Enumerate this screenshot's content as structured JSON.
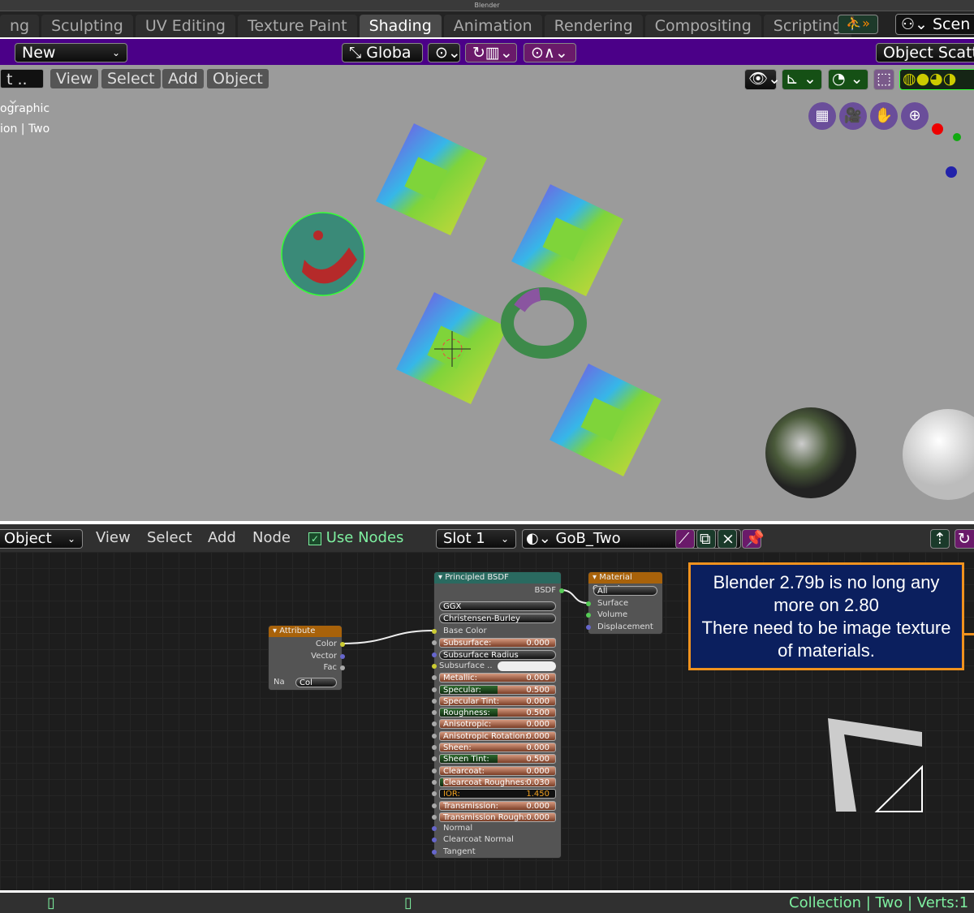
{
  "window": {
    "title": "Blender"
  },
  "workspace_tabs": [
    {
      "label": "ng"
    },
    {
      "label": "Sculpting"
    },
    {
      "label": "UV Editing"
    },
    {
      "label": "Texture Paint"
    },
    {
      "label": "Shading",
      "active": true
    },
    {
      "label": "Animation"
    },
    {
      "label": "Rendering"
    },
    {
      "label": "Compositing"
    },
    {
      "label": "Scripting"
    }
  ],
  "add_tab": "+",
  "scene_label": "Scen",
  "tool_header": {
    "new_label": "New",
    "orientation": "Globa",
    "object_scatter": "Object Scatt"
  },
  "viewport": {
    "mode": "t ..",
    "menus": [
      "View",
      "Select",
      "Add",
      "Object"
    ],
    "overlay_text_1": "ographic",
    "overlay_text_2": "ion | Two"
  },
  "node_header": {
    "object_type": "Object",
    "menus": [
      "View",
      "Select",
      "Add",
      "Node"
    ],
    "use_nodes_label": "Use Nodes",
    "use_nodes_checked": true,
    "slot": "Slot 1",
    "material_name": "GoB_Two"
  },
  "nodes": {
    "attribute": {
      "title": "Attribute",
      "outputs": [
        "Color",
        "Vector",
        "Fac"
      ],
      "name_label": "Na",
      "name_value": "Col"
    },
    "principled": {
      "title": "Principled BSDF",
      "output": "BSDF",
      "distribution": "GGX",
      "subsurface_method": "Christensen-Burley",
      "inputs": [
        {
          "type": "label",
          "label": "Base Color",
          "socket": "yellow"
        },
        {
          "type": "slider",
          "label": "Subsurface:",
          "value": "0.000",
          "fraction": 0
        },
        {
          "type": "dropdown",
          "label": "Subsurface Radius",
          "socket": "blue"
        },
        {
          "type": "color",
          "label": "Subsurface ..",
          "socket": "yellow"
        },
        {
          "type": "slider",
          "label": "Metallic:",
          "value": "0.000",
          "fraction": 0
        },
        {
          "type": "slider",
          "label": "Specular:",
          "value": "0.500",
          "fraction": 0.5
        },
        {
          "type": "slider",
          "label": "Specular Tint:",
          "value": "0.000",
          "fraction": 0
        },
        {
          "type": "slider",
          "label": "Roughness:",
          "value": "0.500",
          "fraction": 0.5
        },
        {
          "type": "slider",
          "label": "Anisotropic:",
          "value": "0.000",
          "fraction": 0
        },
        {
          "type": "slider",
          "label": "Anisotropic Rotation:",
          "value": "0.000",
          "fraction": 0
        },
        {
          "type": "slider",
          "label": "Sheen:",
          "value": "0.000",
          "fraction": 0
        },
        {
          "type": "slider",
          "label": "Sheen Tint:",
          "value": "0.500",
          "fraction": 0.5
        },
        {
          "type": "slider",
          "label": "Clearcoat:",
          "value": "0.000",
          "fraction": 0
        },
        {
          "type": "slider",
          "label": "Clearcoat Roughnes:",
          "value": "0.030",
          "fraction": 0.03
        },
        {
          "type": "number",
          "label": "IOR:",
          "value": "1.450"
        },
        {
          "type": "slider",
          "label": "Transmission:",
          "value": "0.000",
          "fraction": 0
        },
        {
          "type": "slider",
          "label": "Transmission Rough:",
          "value": "0.000",
          "fraction": 0
        },
        {
          "type": "label",
          "label": "Normal",
          "socket": "blue"
        },
        {
          "type": "label",
          "label": "Clearcoat Normal",
          "socket": "blue"
        },
        {
          "type": "label",
          "label": "Tangent",
          "socket": "blue"
        }
      ]
    },
    "material_output": {
      "title": "Material Output",
      "target": "All",
      "inputs": [
        "Surface",
        "Volume",
        "Displacement"
      ]
    }
  },
  "note": {
    "line1": "Blender 2.79b is no long any",
    "line2": "more on 2.80",
    "line3": "There need to be image texture",
    "line4": "of materials."
  },
  "status_bar": {
    "info": "Collection | Two | Verts:1"
  },
  "colors": {
    "accent_purple": "#4b0088",
    "note_border": "#f0921e",
    "note_bg": "#0b1f5e",
    "status_text": "#7ef0a0"
  }
}
